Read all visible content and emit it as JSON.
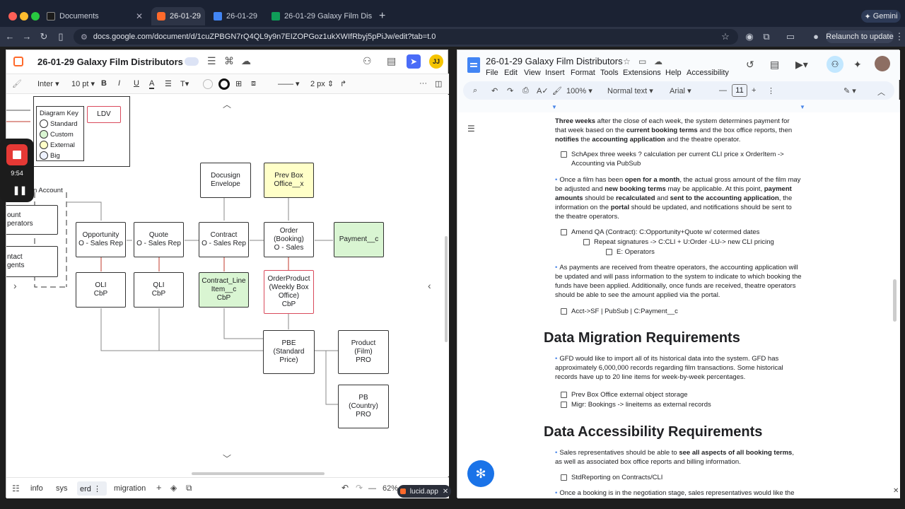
{
  "browser": {
    "tabs": [
      {
        "label": "Documents",
        "active": false
      },
      {
        "label": "26-01-29",
        "active": true
      },
      {
        "label": "26-01-29",
        "active": false
      },
      {
        "label": "26-01-29 Galaxy Film Distribut",
        "active": false
      }
    ],
    "gemini_label": "Gemini",
    "url": "docs.google.com/document/d/1cuZPBGN7rQ4QL9y9n7EIZOPGoz1ukXWIfRbyj5pPiJw/edit?tab=t.0",
    "relaunch_label": "Relaunch to update"
  },
  "lucid": {
    "title": "26-01-29 Galaxy Film Distributors",
    "avatar": "JJ",
    "format": {
      "font": "Inter",
      "size": "10 pt",
      "line_width": "2 px"
    },
    "diagram_key": {
      "title": "Diagram Key",
      "items": [
        "Standard",
        "Custom",
        "External",
        "Big"
      ],
      "ldv_label": "LDV"
    },
    "nodes": {
      "account": "n Account",
      "operators": "ount\nperators",
      "agents": "ntact\ngents",
      "docusign": "Docusign\nEnvelope",
      "prev_box": "Prev Box\nOffice__x",
      "opportunity": "Opportunity\nO - Sales Rep",
      "quote": "Quote\nO - Sales Rep",
      "contract": "Contract\nO - Sales Rep",
      "order": "Order\n(Booking)\nO - Sales",
      "payment": "Payment__c",
      "oli": "OLI\nCbP",
      "qli": "QLI\nCbP",
      "contract_line": "Contract_Line\nItem__c\nCbP",
      "order_product": "OrderProduct\n(Weekly Box\nOffice)\nCbP",
      "pbe": "PBE\n(Standard\nPrice)",
      "product": "Product\n(Film)\nPRO",
      "pb": "PB\n(Country)\nPRO"
    },
    "footer": {
      "tabs": [
        "info",
        "sys",
        "erd",
        "migration"
      ],
      "active_tab": "erd",
      "zoom": "62%",
      "lucid_pill": "lucid.app"
    }
  },
  "recorder": {
    "time": "9:54"
  },
  "docs": {
    "title": "26-01-29 Galaxy Film Distributors",
    "menu": [
      "File",
      "Edit",
      "View",
      "Insert",
      "Format",
      "Tools",
      "Extensions",
      "Help",
      "Accessibility"
    ],
    "toolbar": {
      "zoom": "100%",
      "style": "Normal text",
      "font": "Arial",
      "size": "11"
    },
    "content": {
      "p1_b1": "Three weeks",
      "p1_t1": " after the close of each week, the system determines payment for that week based on the ",
      "p1_b2": "current booking terms",
      "p1_t2": " and the box office reports, then ",
      "p1_b3": "notifies",
      "p1_t3": " the ",
      "p1_b4": "accounting application",
      "p1_t4": " and the theatre operator.",
      "c1": "SchApex three weeks ? calculation per current CLI price x OrderItem -> Accounting via PubSub",
      "p2_t1": "Once a film has been ",
      "p2_b1": "open for a month",
      "p2_t2": ", the actual gross amount of the film may be adjusted and ",
      "p2_b2": "new booking terms",
      "p2_t3": " may be applicable. At this point, ",
      "p2_b3": "payment amounts",
      "p2_t4": " should be ",
      "p2_b4": "recalculated",
      "p2_t5": " and ",
      "p2_b5": "sent to the accounting application",
      "p2_t6": ", the information on the ",
      "p2_b6": "portal",
      "p2_t7": " should be updated, and notifications should be sent to the theatre operators.",
      "c2": "Amend QA (Contract): C:Opportunity+Quote w/ cotermed dates",
      "c3": "Repeat signatures -> C:CLI + U:Order -LU-> new CLI pricing",
      "c4": "E: Operators",
      "p3": "As payments are received from theatre operators, the accounting application will be updated and will pass information to the system to indicate to which booking the funds have been applied. Additionally, once funds are received, theatre operators should be able to see the amount applied via the portal.",
      "c5": "Acct->SF | PubSub | C:Payment__c",
      "h_migration": "Data Migration Requirements",
      "p4": "GFD would like to import all of its historical data into the system. GFD has approximately 6,000,000 records regarding film transactions. Some historical records have up to 20 line items for week-by-week percentages.",
      "c6": "Prev Box Office external object storage",
      "c7": "Migr: Bookings -> lineitems as external records",
      "h_access": "Data Accessibility Requirements",
      "p5_t1": "Sales representatives should be able to ",
      "p5_b1": "see all aspects of all booking terms",
      "p5_t2": ", as well as associated box office reports and billing information.",
      "c8": "StdReporting on Contracts/CLI",
      "p6": "Once a booking is in the negotiation stage, sales representatives would like the"
    }
  }
}
